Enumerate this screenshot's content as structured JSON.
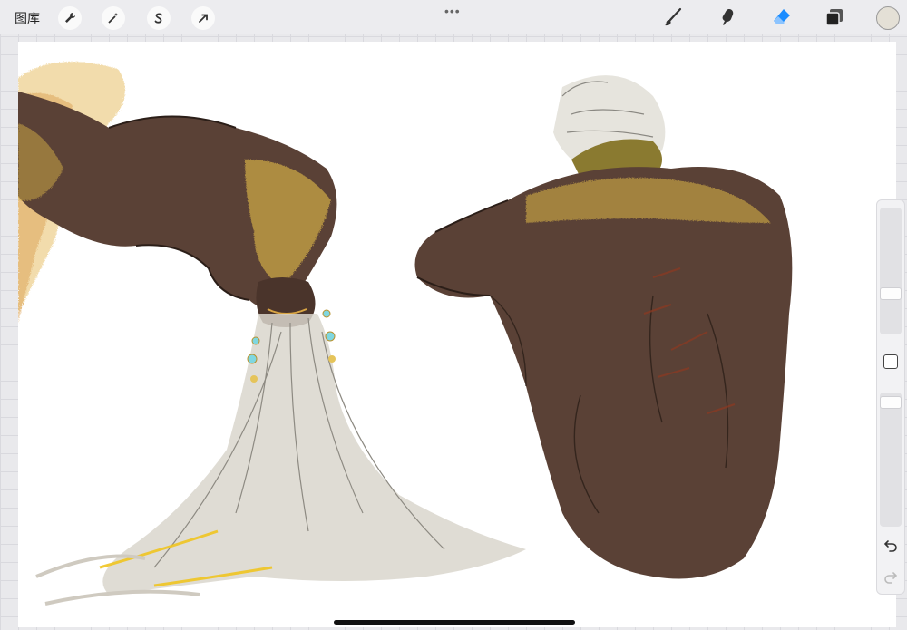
{
  "topbar": {
    "gallery_label": "图库",
    "left_tools": [
      {
        "name": "wrench-icon"
      },
      {
        "name": "magic-wand-icon"
      },
      {
        "name": "selection-s-icon"
      },
      {
        "name": "transform-arrow-icon"
      }
    ],
    "more_menu": "•••",
    "right_tools": [
      {
        "name": "brush-icon"
      },
      {
        "name": "smudge-icon"
      },
      {
        "name": "eraser-icon",
        "active": true
      },
      {
        "name": "layers-icon"
      }
    ],
    "current_color": "#e4e0d6"
  },
  "colors": {
    "accent": "#1a8cff",
    "skin_dark": "#5a4136",
    "gold": "#c9a544",
    "hair": "#d9d6cc"
  },
  "sidebar": {
    "tools": [
      "brush-size-slider",
      "modify-button",
      "opacity-slider",
      "undo-icon",
      "redo-icon"
    ]
  }
}
